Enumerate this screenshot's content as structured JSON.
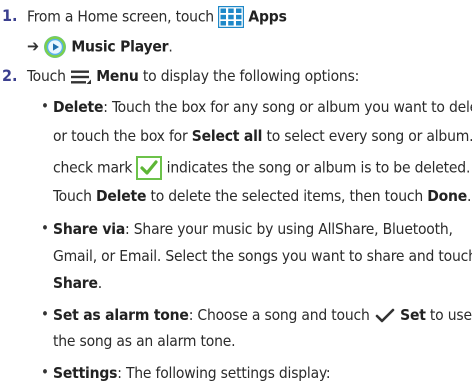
{
  "steps": [
    {
      "number": "1.",
      "line1_prefix": "From a Home screen, touch",
      "apps_label": "Apps",
      "arrow": "➔",
      "music_player_label": "Music Player",
      "music_player_suffix": "."
    },
    {
      "number": "2.",
      "prefix": "Touch",
      "menu_label": "Menu",
      "suffix": "to display the following options:"
    }
  ],
  "bullets": {
    "delete": {
      "term": "Delete",
      "l1": ": Touch the box for any song or album you want to delete",
      "l2_a": "or touch the box for",
      "l2_b": "Select all",
      "l2_c": "to select every song or album. A",
      "l3_a": "check mark",
      "l3_b": "indicates the song or album is to be deleted.",
      "l4_a": "Touch",
      "l4_b": "Delete",
      "l4_c": "to delete the selected items, then touch",
      "l4_d": "Done",
      "l4_e": "."
    },
    "share": {
      "term": "Share via",
      "l1": ": Share your music by using AllShare, Bluetooth,",
      "l2": "Gmail, or Email. Select the songs you want to share and touch",
      "l3_a": "Share",
      "l3_b": "."
    },
    "alarm": {
      "term": "Set as alarm tone",
      "l1": ": Choose a song and touch",
      "set_label": "Set",
      "l1_end": "to use",
      "l2": "the song as an alarm tone."
    },
    "settings": {
      "term": "Settings",
      "l1": ": The following settings display:"
    },
    "bullet_char": "•"
  },
  "icons": {
    "apps": "apps-grid-icon",
    "music_player": "music-player-icon",
    "menu": "menu-icon",
    "checkbox": "green-check-icon",
    "check": "check-icon"
  },
  "colors": {
    "step_number": "#3b3f8f",
    "apps_grid": "#1e88c8",
    "checkbox_green": "#6cc24a"
  }
}
